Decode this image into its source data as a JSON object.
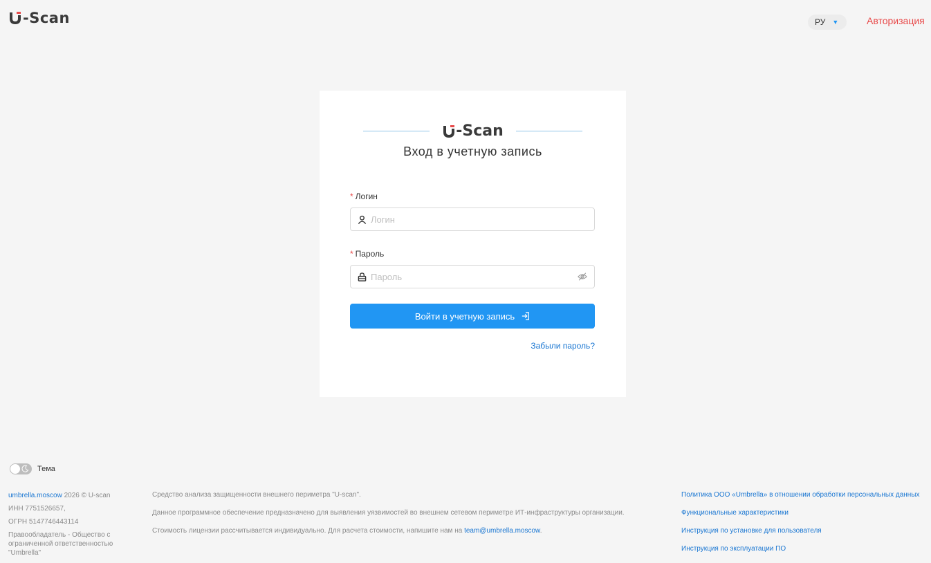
{
  "header": {
    "logo_text": "-Scan",
    "language": "РУ",
    "auth_link": "Авторизация"
  },
  "login_card": {
    "logo_text": "-Scan",
    "title": "Вход в учетную запись",
    "login_label": "Логин",
    "login_placeholder": "Логин",
    "login_value": "",
    "password_label": "Пароль",
    "password_placeholder": "Пароль",
    "password_value": "",
    "required_mark": "*",
    "submit_label": "Войти в учетную запись",
    "forgot_link": "Забыли пароль?"
  },
  "theme": {
    "label": "Тема"
  },
  "footer": {
    "site_link": "umbrella.moscow",
    "copyright": " 2026 © U-scan",
    "inn": "ИНН 7751526657,",
    "ogrn": "ОГРН 5147746443114",
    "rightholder": "Правообладатель - Общество с ограниченной ответственностью \"Umbrella\"",
    "desc1": "Средство анализа защищенности внешнего периметра \"U-scan\".",
    "desc2": "Данное программное обеспечение предназначено для выявления уязвимостей во внешнем сетевом периметре ИТ-инфраструктуры организации.",
    "desc3_prefix": "Стоимость лицензии рассчитывается индивидуально. Для расчета стоимости, напишите нам на ",
    "email": "team@umbrella.moscow",
    "desc3_suffix": ".",
    "links": [
      "Политика ООО «Umbrella» в отношении обработки персональных данных",
      "Функциональные характеристики",
      "Инструкция по установке для пользователя",
      "Инструкция по эксплуатации ПО"
    ]
  },
  "colors": {
    "accent": "#2196f3",
    "auth_link": "#e84a4a",
    "link": "#1976d2",
    "background": "#f5f5f5"
  }
}
